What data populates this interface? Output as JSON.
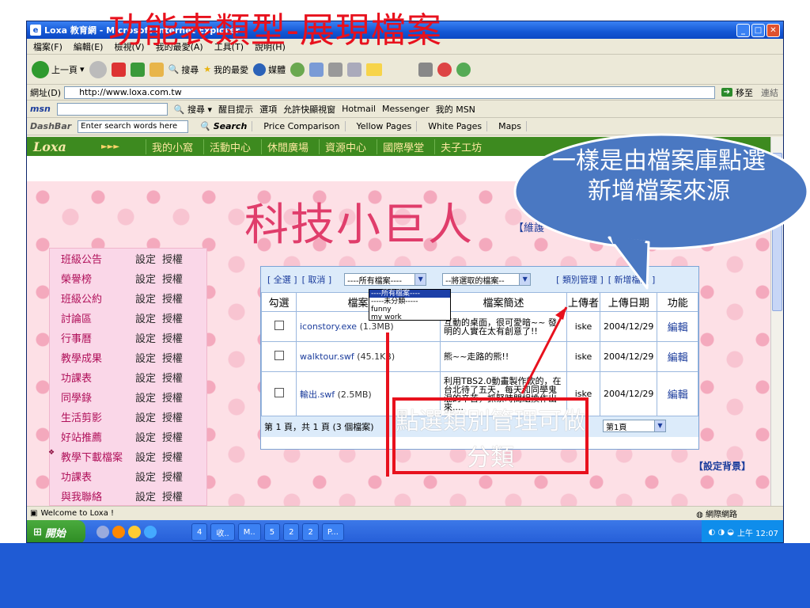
{
  "slide": {
    "title": "功能表類型-展現檔案",
    "callout": "一樣是由檔案庫點選新增檔案來源",
    "annotation": "點選類別管理可做分類"
  },
  "browser": {
    "title": "Loxa 教育網 - Microsoft Internet Explorer",
    "menu": [
      "檔案(F)",
      "編輯(E)",
      "檢視(V)",
      "我的最愛(A)",
      "工具(T)",
      "說明(H)"
    ],
    "toolbar": {
      "back": "上一頁",
      "search": "搜尋",
      "favorites": "我的最愛",
      "media": "媒體"
    },
    "address_label": "網址(D)",
    "address_value": "http://www.loxa.com.tw",
    "go_label": "移至",
    "links_label": "連結",
    "msn": {
      "logo": "msn",
      "search": "搜尋",
      "highlight": "醒目提示",
      "options": "選項",
      "popup": "允許快顯視窗",
      "hotmail": "Hotmail",
      "messenger": "Messenger",
      "mymsn": "我的 MSN"
    },
    "dashbar": {
      "logo": "DashBar",
      "placeholder": "Enter search words here",
      "search": "Search",
      "links": [
        "Price Comparison",
        "Yellow Pages",
        "White Pages",
        "Maps"
      ]
    },
    "status": "Welcome to Loxa !",
    "status_zone": "網際網路"
  },
  "site": {
    "logo": "Loxa",
    "arrows": "►►►",
    "nav": [
      "我的小窩",
      "活動中心",
      "休閒廣場",
      "資源中心",
      "國際學堂",
      "夫子工坊"
    ],
    "page_title": "科技小巨人",
    "maintain": "【維護",
    "set_background": "【設定背景】",
    "sidemenu": [
      {
        "label": "班級公告",
        "set": "設定",
        "auth": "授權"
      },
      {
        "label": "榮譽榜",
        "set": "設定",
        "auth": "授權"
      },
      {
        "label": "班級公約",
        "set": "設定",
        "auth": "授權"
      },
      {
        "label": "討論區",
        "set": "設定",
        "auth": "授權"
      },
      {
        "label": "行事曆",
        "set": "設定",
        "auth": "授權"
      },
      {
        "label": "教學成果",
        "set": "設定",
        "auth": "授權"
      },
      {
        "label": "功課表",
        "set": "設定",
        "auth": "授權"
      },
      {
        "label": "同學錄",
        "set": "設定",
        "auth": "授權"
      },
      {
        "label": "生活剪影",
        "set": "設定",
        "auth": "授權"
      },
      {
        "label": "好站推薦",
        "set": "設定",
        "auth": "授權"
      },
      {
        "label": "教學下載檔案",
        "set": "設定",
        "auth": "授權"
      },
      {
        "label": "功課表",
        "set": "設定",
        "auth": "授權"
      },
      {
        "label": "與我聯絡",
        "set": "設定",
        "auth": "授權"
      }
    ],
    "panel": {
      "select_all": "[ 全選 ]",
      "cancel": "[ 取消 ]",
      "category_select": "----所有檔案----",
      "action_select": "--將選取的檔案--",
      "category_manage": "[ 類別管理 ]",
      "add_file": "[ 新增檔案 ]",
      "dropdown_options": [
        "----所有檔案----",
        "-----未分類-----",
        "funny",
        "my work"
      ],
      "headers": [
        "勾選",
        "檔案名稱",
        "檔案簡述",
        "上傳者",
        "上傳日期",
        "功能"
      ],
      "rows": [
        {
          "name": "iconstory.exe",
          "size": "(1.3MB)",
          "desc": "互動的桌面，很可愛暗~~ 發明的人實在太有創意了!!",
          "uploader": "iske",
          "date": "2004/12/29",
          "action": "編輯"
        },
        {
          "name": "walktour.swf",
          "size": "(45.1KB)",
          "desc": "熊~~走路的熊!!",
          "uploader": "iske",
          "date": "2004/12/29",
          "action": "編輯"
        },
        {
          "name": "輸出.swf",
          "size": "(2.5MB)",
          "desc": "利用TBS2.0動畫製作軟的，在台北待了五天，每天和同學鬼混的辛苦，抓緊時間組換作出來....",
          "uploader": "iske",
          "date": "2004/12/29",
          "action": "編輯"
        }
      ],
      "footer": "第 1 頁，共 1 頁 (3 個檔案)",
      "page_select": "第1頁"
    }
  },
  "taskbar": {
    "start": "開始",
    "tasks": [
      "4",
      "收..",
      "M..",
      "5",
      "2",
      "2",
      "P..."
    ],
    "clock": "上午 12:07"
  },
  "colors": {
    "title_red": "#e8111d",
    "callout_fill": "#4a78c2",
    "site_nav_green": "#3d8a1f",
    "pink_title": "#e03d6b"
  }
}
